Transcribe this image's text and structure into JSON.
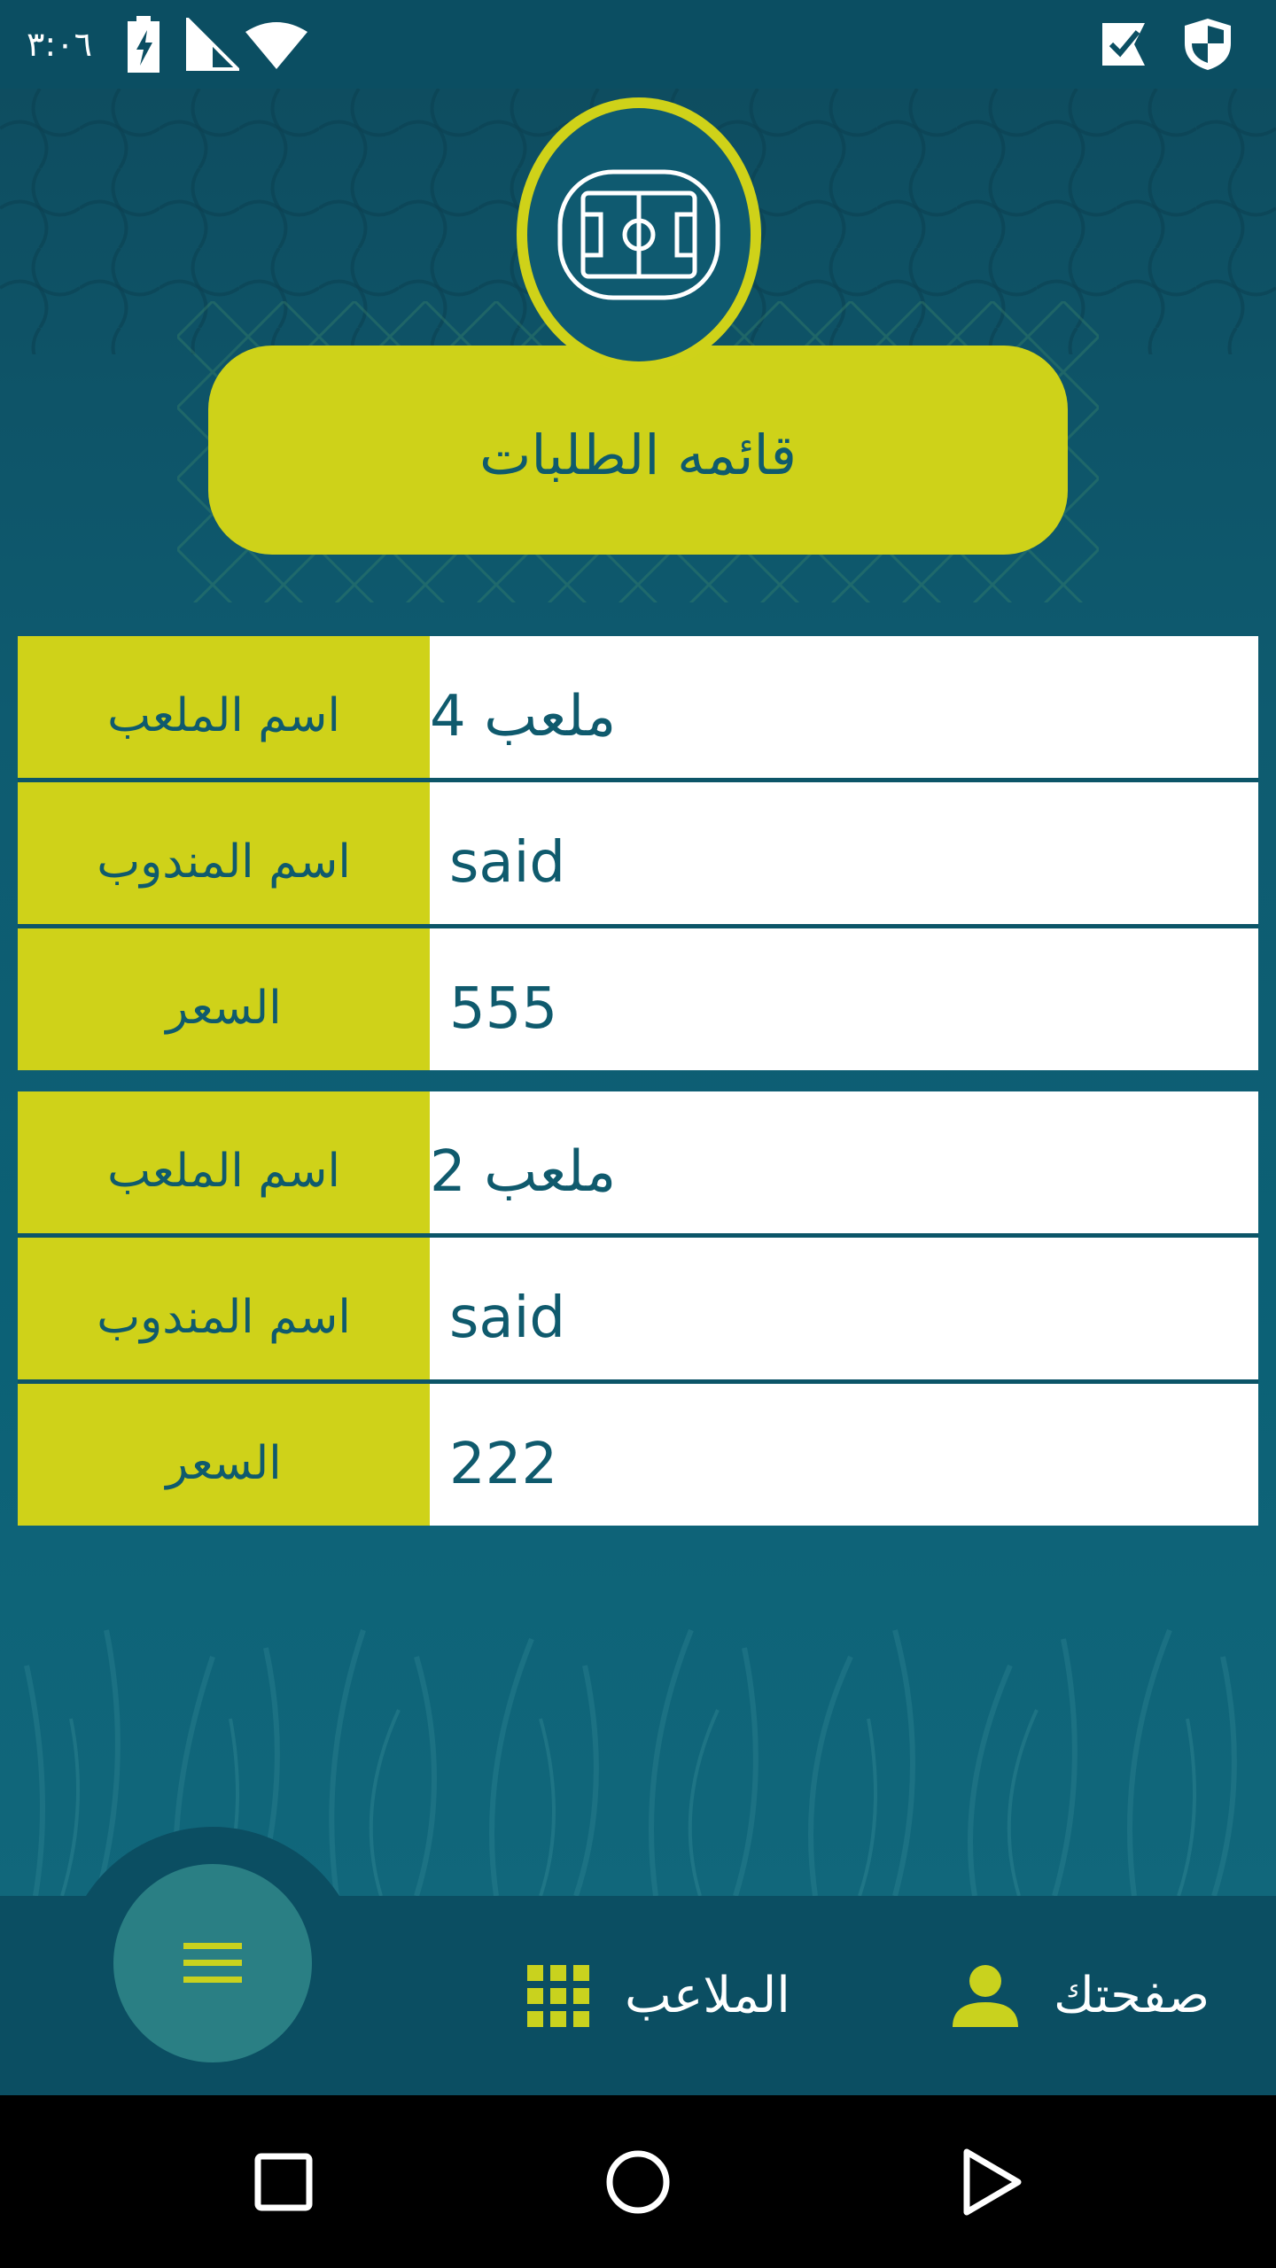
{
  "status_bar": {
    "time": "٣:٠٦"
  },
  "header": {
    "title": "قائمه الطلبات"
  },
  "orders": [
    {
      "field_label": "اسم الملعب",
      "field_value": "ملعب 4",
      "agent_label": "اسم المندوب",
      "agent_value": "said",
      "price_label": "السعر",
      "price_value": "555"
    },
    {
      "field_label": "اسم الملعب",
      "field_value": "ملعب 2",
      "agent_label": "اسم المندوب",
      "agent_value": "said",
      "price_label": "السعر",
      "price_value": "222"
    }
  ],
  "bottom_nav": {
    "stadiums_label": "الملاعب",
    "profile_label": "صفحتك"
  },
  "colors": {
    "accent": "#ced219",
    "primary": "#0f5a6d",
    "nav": "#0b4e62"
  }
}
